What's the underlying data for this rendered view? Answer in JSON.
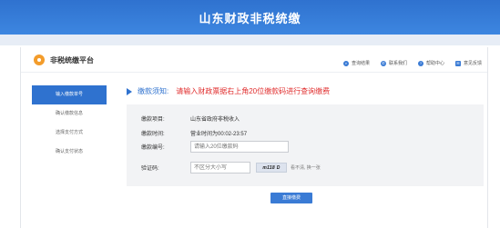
{
  "header": {
    "title": "山东财政非税统缴"
  },
  "platform": {
    "name": "非税统缴平台"
  },
  "top_links": [
    {
      "label": "查询结果",
      "icon": "search-icon"
    },
    {
      "label": "联系我们",
      "icon": "phone-icon"
    },
    {
      "label": "帮助中心",
      "icon": "help-icon"
    },
    {
      "label": "意见反馈",
      "icon": "feedback-icon"
    }
  ],
  "sidebar": {
    "items": [
      {
        "label": "输入缴款单号",
        "active": true
      },
      {
        "label": "确认缴款信息",
        "active": false
      },
      {
        "label": "选择支付方式",
        "active": false
      },
      {
        "label": "确认支付状态",
        "active": false
      }
    ]
  },
  "notice": {
    "label": "缴款须知:",
    "message": "请输入财政票据右上角20位缴款码进行查询缴费"
  },
  "form": {
    "item_label": "缴款项目:",
    "item_value": "山东省政府非税收入",
    "time_label": "缴款时间:",
    "time_value": "营业时间为00:02-23:57",
    "code_label": "缴款编号:",
    "code_placeholder": "请输入20位缴款码",
    "captcha_label": "验证码:",
    "captcha_placeholder": "不区分大小写",
    "captcha_image_text": "m118 D",
    "refresh_text": "看不清, 换一张"
  },
  "actions": {
    "submit_label": "直接缴费"
  },
  "colors": {
    "primary": "#2f72cf",
    "notice_red": "#e02d2d",
    "logo_orange": "#f39c2b"
  }
}
